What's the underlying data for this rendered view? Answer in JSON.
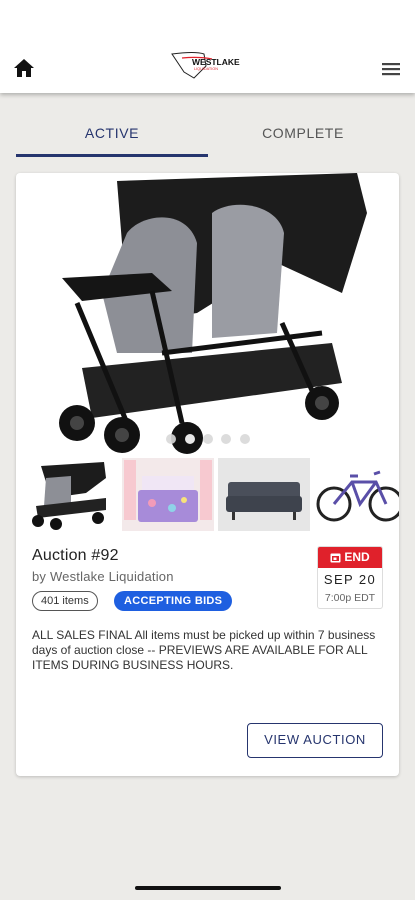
{
  "header": {
    "logo_text": "WESTLAKE",
    "logo_subtext": "LIQUIDATION",
    "home_icon": "home-icon",
    "menu_icon": "hamburger-menu-icon"
  },
  "tabs": [
    {
      "label": "ACTIVE",
      "selected": true
    },
    {
      "label": "COMPLETE",
      "selected": false
    }
  ],
  "auction": {
    "title": "Auction #92",
    "by": "by Westlake Liquidation",
    "item_count": "401 items",
    "status": "ACCEPTING BIDS",
    "end_label": "END",
    "end_date": "SEP 20",
    "end_time": "7:00p EDT",
    "description": "ALL SALES FINAL All items must be picked up within 7 business days of auction close -- PREVIEWS ARE AVAILABLE FOR ALL ITEMS DURING BUSINESS HOURS.",
    "view_button": "VIEW AUCTION",
    "carousel_dots": 5,
    "carousel_active": 1,
    "thumbnails": [
      "double-stroller",
      "kids-bedding-set",
      "gray-sofa",
      "mountain-bike"
    ]
  },
  "colors": {
    "primary": "#26356e",
    "status_chip": "#1e5fe0",
    "end_badge": "#e0212b",
    "background": "#ecebe8"
  }
}
